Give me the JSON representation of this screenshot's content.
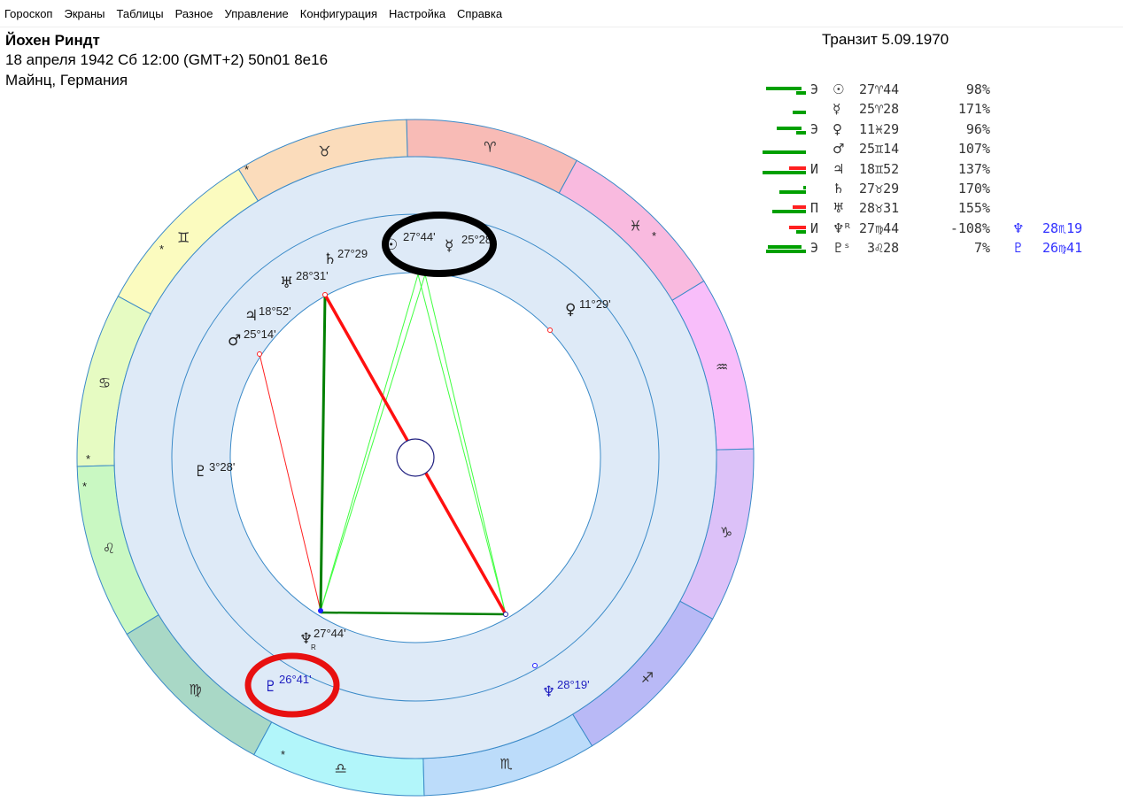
{
  "menu": [
    "Гороскоп",
    "Экраны",
    "Таблицы",
    "Разное",
    "Управление",
    "Конфигурация",
    "Настройка",
    "Справка"
  ],
  "header": {
    "name": "Йохен Риндт",
    "datetime": "18 апреля 1942  Сб  12:00 (GMT+2) 50n01  8e16",
    "place": "Майнц, Германия",
    "transit": "Транзит  5.09.1970"
  },
  "table": [
    {
      "letter": "Э",
      "glyph": "☉",
      "pos": "27♈44",
      "pct": "98%",
      "tglyph": "",
      "tpos": ""
    },
    {
      "letter": "",
      "glyph": "☿",
      "pos": "25♈28",
      "pct": "171%",
      "tglyph": "",
      "tpos": ""
    },
    {
      "letter": "Э",
      "glyph": "♀",
      "pos": "11♓29",
      "pct": "96%",
      "tglyph": "",
      "tpos": ""
    },
    {
      "letter": "",
      "glyph": "♂",
      "pos": "25♊14",
      "pct": "107%",
      "tglyph": "",
      "tpos": ""
    },
    {
      "letter": "И",
      "glyph": "♃",
      "pos": "18♊52",
      "pct": "137%",
      "tglyph": "",
      "tpos": ""
    },
    {
      "letter": "",
      "glyph": "♄",
      "pos": "27♉29",
      "pct": "170%",
      "tglyph": "",
      "tpos": ""
    },
    {
      "letter": "П",
      "glyph": "♅",
      "pos": "28♉31",
      "pct": "155%",
      "tglyph": "",
      "tpos": ""
    },
    {
      "letter": "И",
      "glyph": "♆ᴿ",
      "pos": "27♍44",
      "pct": "-108%",
      "tglyph": "♆",
      "tpos": "28♏19"
    },
    {
      "letter": "Э",
      "glyph": "♇ˢ",
      "pos": " 3♌28",
      "pct": "7%",
      "tglyph": "♇",
      "tpos": "26♍41"
    }
  ],
  "signs": [
    "♈",
    "♉",
    "♊",
    "♋",
    "♌",
    "♍",
    "♎",
    "♏",
    "♐",
    "♑",
    "♒",
    "♓"
  ],
  "sign_colors": [
    "#f8bbb6",
    "#fbdcbb",
    "#fbfbbf",
    "#e6fbc2",
    "#c9f8c2",
    "#a9d8c6",
    "#b2f6fa",
    "#bcdcfa",
    "#b9b9f6",
    "#dcc1f8",
    "#f8befa",
    "#f9badf"
  ],
  "wheel": {
    "sun": {
      "glyph": "☉",
      "label": "27°44'"
    },
    "mercury": {
      "glyph": "☿",
      "label": "25°28"
    },
    "saturn": {
      "glyph": "♄",
      "label": "27°29"
    },
    "uranus": {
      "glyph": "♅",
      "label": "28°31'"
    },
    "jupiter": {
      "glyph": "♃",
      "label": "18°52'"
    },
    "mars": {
      "glyph": "♂",
      "label": "25°14'"
    },
    "venus": {
      "glyph": "♀",
      "label": "11°29'"
    },
    "pluto": {
      "glyph": "♇",
      "label": "3°28'"
    },
    "neptune": {
      "glyph": "♆",
      "label": "27°44'",
      "retro": "R"
    },
    "transit_pluto": {
      "glyph": "♇",
      "label": "26°41'"
    },
    "transit_neptune": {
      "glyph": "♆",
      "label": "28°19'"
    },
    "asterisk": "*"
  }
}
